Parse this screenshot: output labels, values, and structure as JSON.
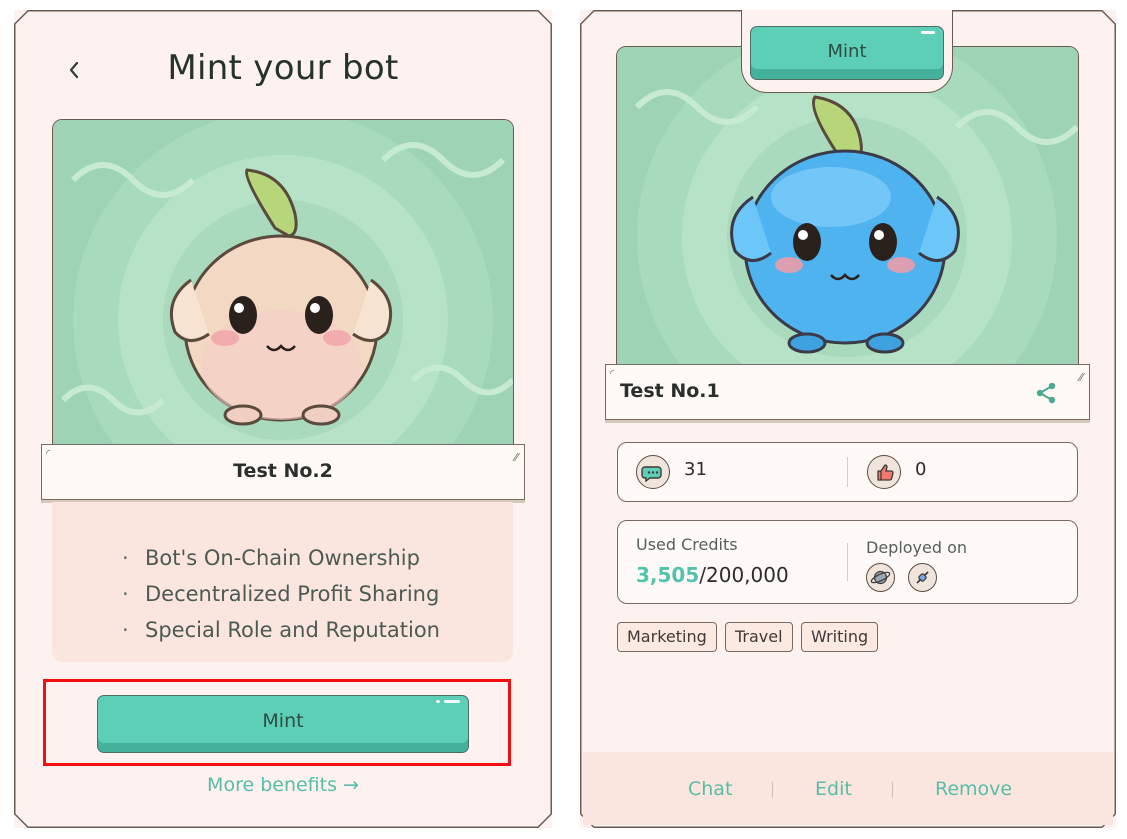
{
  "left_panel": {
    "title": "Mint your bot",
    "bot_name": "Test No.2",
    "benefits": [
      "Bot's On-Chain Ownership",
      "Decentralized Profit Sharing",
      "Special Role and Reputation"
    ],
    "mint_label": "Mint",
    "more_benefits_label": "More benefits →",
    "icons": {
      "back": "chevron-left-icon"
    }
  },
  "right_panel": {
    "mint_label": "Mint",
    "bot_name": "Test No.1",
    "chat_count": "31",
    "like_count": "0",
    "used_credits_label": "Used Credits",
    "credits_used": "3,505",
    "credits_total": "/200,000",
    "deployed_on_label": "Deployed on",
    "tags": [
      "Marketing",
      "Travel",
      "Writing"
    ],
    "actions": {
      "chat": "Chat",
      "edit": "Edit",
      "remove": "Remove"
    },
    "icons": {
      "share": "share-icon",
      "chats": "chat-bubbles-icon",
      "likes": "thumbs-up-icon",
      "platform_1": "planet-icon",
      "platform_2": "plug-icon"
    }
  },
  "colors": {
    "accent": "#5ecfb7",
    "link": "#58bda7",
    "panel_bg": "#fdf2ef",
    "highlight_box": "#f20e12",
    "credits_used": "#54c3ab"
  }
}
